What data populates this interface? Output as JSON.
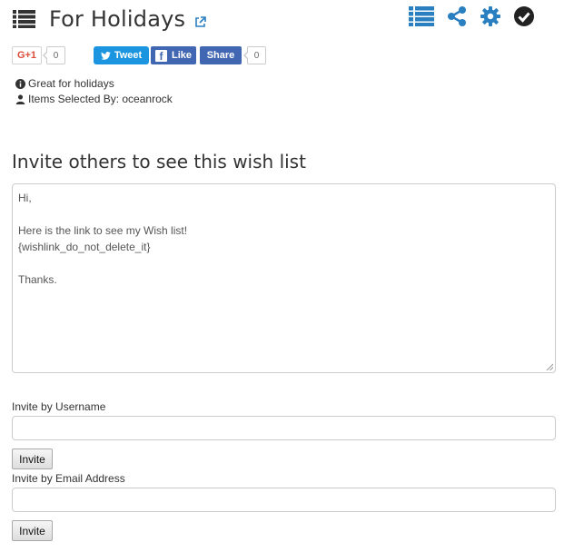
{
  "header": {
    "title": "For Holidays",
    "title_icon": "list-icon",
    "link_icon": "external-link-icon",
    "toolbar_icons": [
      "list-icon",
      "share-icon",
      "gear-icon",
      "check-circle-icon"
    ],
    "accent_color": "#2a7fc1"
  },
  "social": {
    "gplus_label": "G+1",
    "gplus_count": "0",
    "tweet_label": "Tweet",
    "like_label": "Like",
    "share_label": "Share",
    "share_count": "0"
  },
  "meta": {
    "description": "Great for holidays",
    "selected_by": "Items Selected By: oceanrock"
  },
  "invite": {
    "heading": "Invite others to see this wish list",
    "message_lines": [
      "Hi,",
      "",
      "Here is the link to see my Wish list!",
      "{wishlink_do_not_delete_it}",
      "",
      "Thanks."
    ],
    "username_label": "Invite by Username",
    "username_value": "",
    "email_label": "Invite by Email Address",
    "email_value": "",
    "invite_button": "Invite"
  }
}
